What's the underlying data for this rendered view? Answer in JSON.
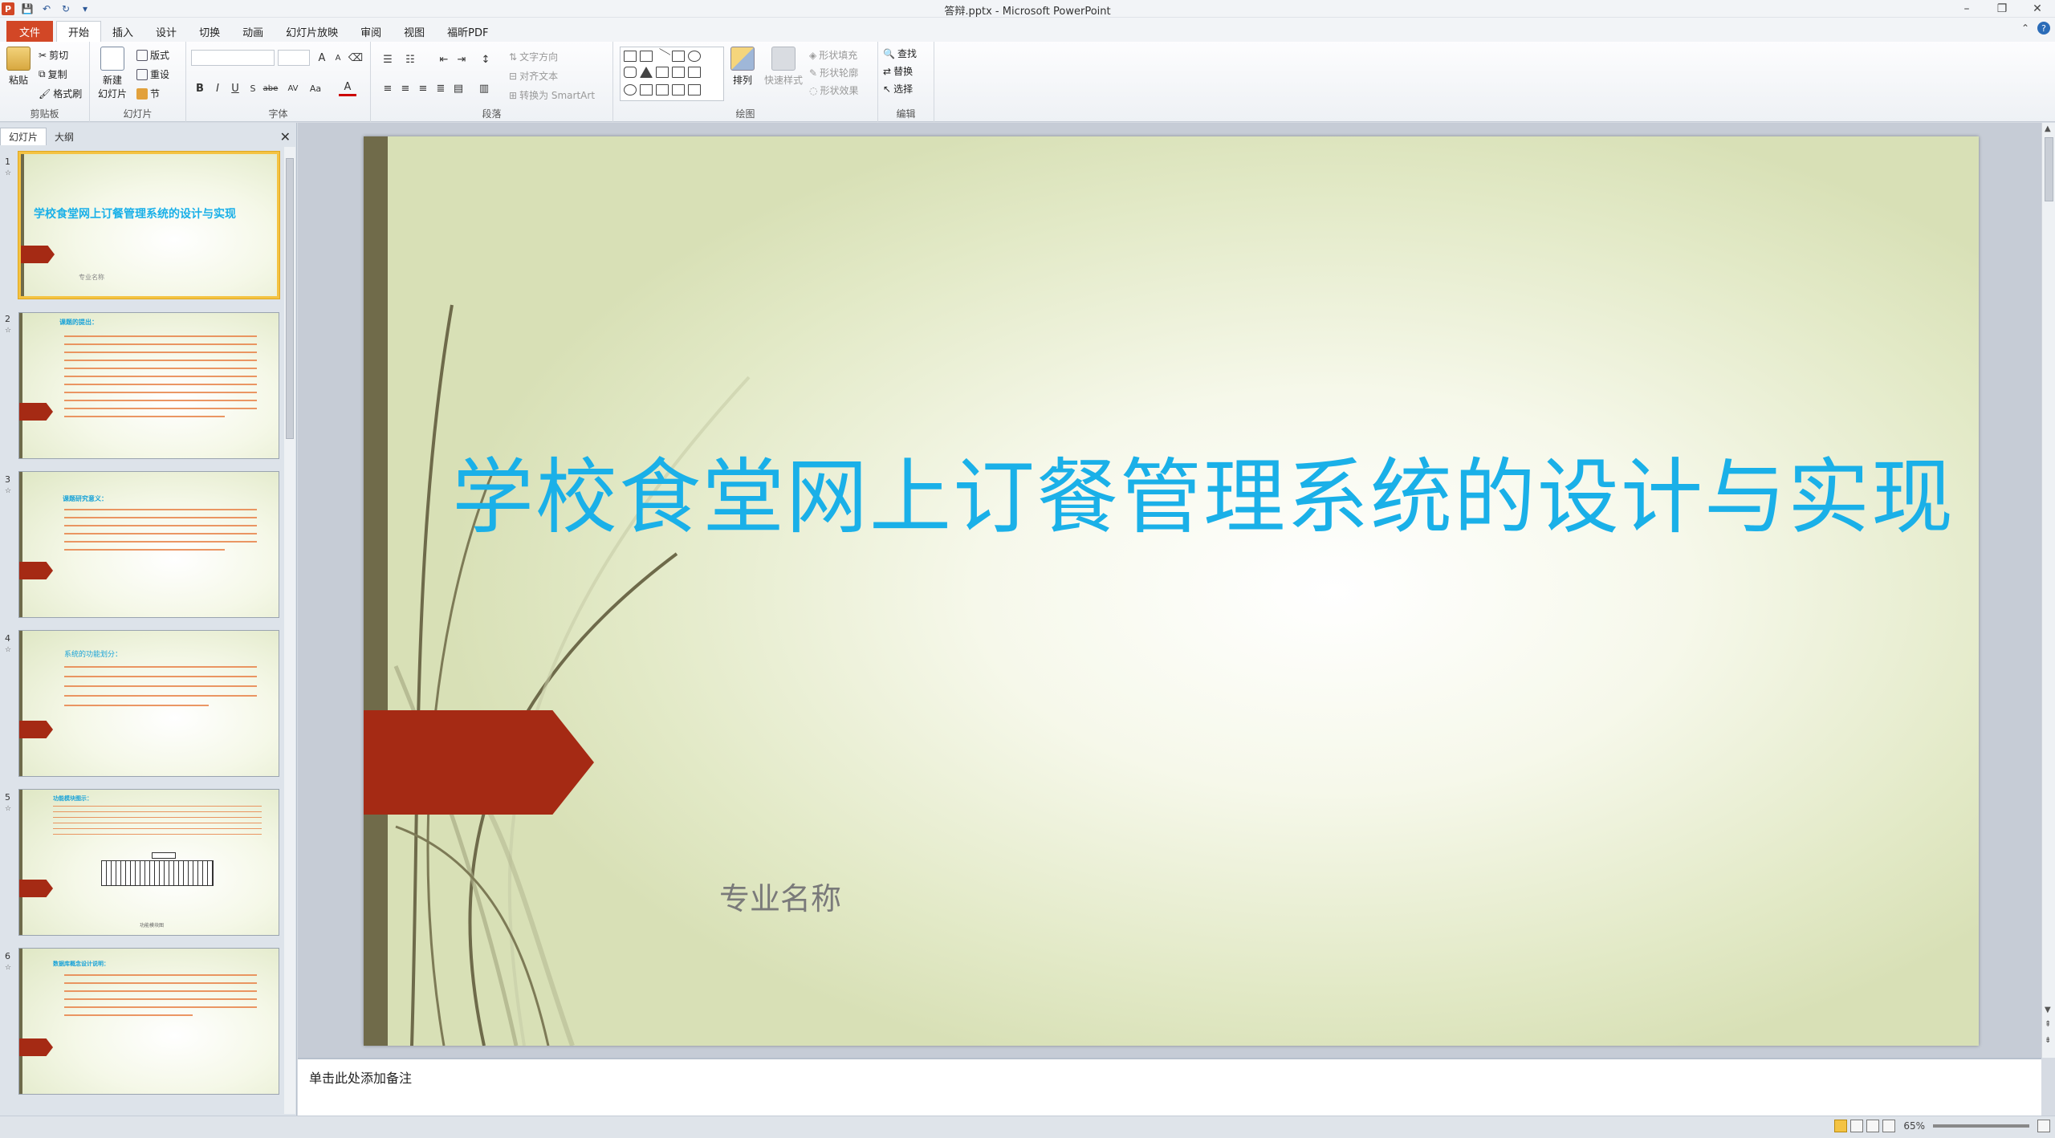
{
  "window": {
    "title": "答辩.pptx - Microsoft PowerPoint",
    "minimize": "–",
    "restore": "❐",
    "close": "✕"
  },
  "tabs": [
    {
      "label": "文件"
    },
    {
      "label": "开始"
    },
    {
      "label": "插入"
    },
    {
      "label": "设计"
    },
    {
      "label": "切换"
    },
    {
      "label": "动画"
    },
    {
      "label": "幻灯片放映"
    },
    {
      "label": "审阅"
    },
    {
      "label": "视图"
    },
    {
      "label": "福昕PDF"
    }
  ],
  "ribbon": {
    "clipboard": {
      "label": "剪贴板",
      "paste": "粘贴",
      "cut": "剪切",
      "copy": "复制",
      "format_painter": "格式刷"
    },
    "slides": {
      "label": "幻灯片",
      "new_slide": "新建\n幻灯片",
      "layout": "版式",
      "reset": "重设",
      "section": "节"
    },
    "font": {
      "label": "字体",
      "bold": "B",
      "italic": "I",
      "underline": "U",
      "strike": "S",
      "shadow": "abe",
      "spacing": "AV",
      "case": "Aa",
      "color": "A",
      "grow": "A",
      "shrink": "A"
    },
    "paragraph": {
      "label": "段落",
      "text_direction": "文字方向",
      "align_text": "对齐文本",
      "smartart": "转换为 SmartArt"
    },
    "drawing": {
      "label": "绘图",
      "arrange": "排列",
      "quick_styles": "快速样式",
      "shape_fill": "形状填充",
      "shape_outline": "形状轮廓",
      "shape_effects": "形状效果"
    },
    "editing": {
      "label": "编辑",
      "find": "查找",
      "replace": "替换",
      "select": "选择"
    }
  },
  "left_pane": {
    "tab_slides": "幻灯片",
    "tab_outline": "大纲",
    "close": "✕",
    "thumbs": [
      {
        "num": "1",
        "title": "学校食堂网上订餐管理系统的设计与实现",
        "sub": "专业名称"
      },
      {
        "num": "2",
        "title": "课题的提出："
      },
      {
        "num": "3",
        "title": "课题研究意义："
      },
      {
        "num": "4",
        "title": "系统的功能划分："
      },
      {
        "num": "5",
        "title": "功能模块图示：",
        "caption": "功能模块图"
      },
      {
        "num": "6",
        "title": "数据库概念设计说明："
      }
    ]
  },
  "slide": {
    "title": "学校食堂网上订餐管理系统的设计与实现",
    "subtitle": "专业名称"
  },
  "notes": {
    "placeholder": "单击此处添加备注"
  },
  "status": {
    "zoom": "65%"
  }
}
